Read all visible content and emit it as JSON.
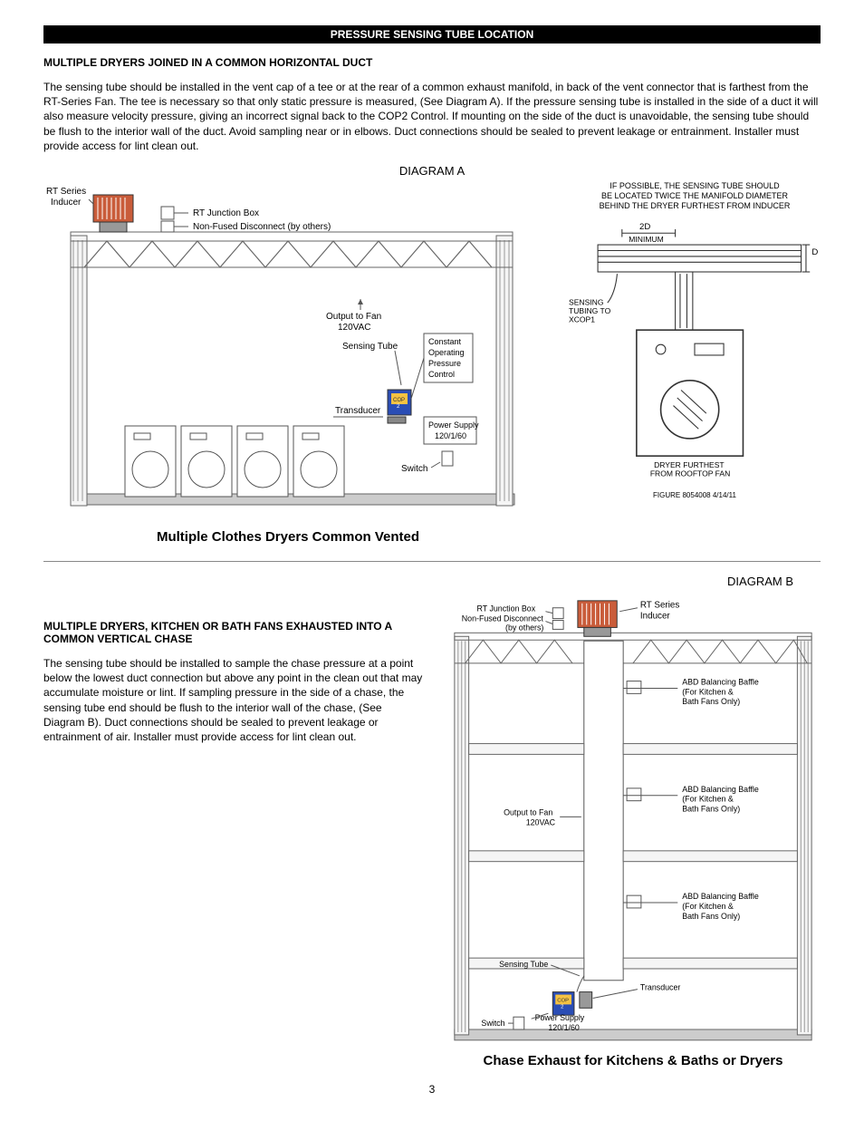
{
  "section_bar": "PRESSURE SENSING TUBE LOCATION",
  "sectionA": {
    "heading": "MULTIPLE DRYERS JOINED IN A COMMON HORIZONTAL DUCT",
    "para": "The sensing tube should be installed in the vent cap of a tee or at the rear of a common exhaust manifold, in back of the vent connector that is farthest from the RT-Series Fan. The tee is necessary so that only static pressure is measured, (See Diagram A). If the pressure sensing tube is installed in the side of a duct it will also measure velocity pressure, giving an incorrect signal back to the COP2 Control. If mounting on the side of the duct is unavoidable, the sensing tube should be flush to the interior wall of the duct. Avoid sampling near or in elbows. Duct connections should be sealed to prevent leakage or entrainment. Installer must provide access for lint clean out.",
    "diagram_label": "DIAGRAM A",
    "caption": "Multiple Clothes Dryers Common Vented",
    "callouts": {
      "rt_series": "RT Series",
      "inducer": "Inducer",
      "rt_junction": "RT Junction Box",
      "disconnect": "Non-Fused Disconnect (by others)",
      "output_to_fan": "Output to Fan",
      "voltage": "120VAC",
      "sensing_tube": "Sensing Tube",
      "cop_line1": "Constant",
      "cop_line2": "Operating",
      "cop_line3": "Pressure",
      "cop_line4": "Control",
      "transducer": "Transducer",
      "power_supply": "Power Supply",
      "power_hz": "120/1/60",
      "switch": "Switch"
    },
    "right_note1": "IF POSSIBLE, THE SENSING TUBE SHOULD",
    "right_note2": "BE LOCATED TWICE THE MANIFOLD DIAMETER",
    "right_note3": "BEHIND THE DRYER FURTHEST FROM INDUCER",
    "right_2d": "2D",
    "right_min": "MINIMUM",
    "right_d": "D",
    "right_sensing1": "SENSING",
    "right_sensing2": "TUBING TO",
    "right_sensing3": "XCOP1",
    "right_dryer1": "DRYER FURTHEST",
    "right_dryer2": "FROM ROOFTOP FAN",
    "right_fig": "FIGURE 8054008   4/14/11"
  },
  "sectionB": {
    "heading": "MULTIPLE DRYERS, KITCHEN OR BATH FANS EXHAUSTED INTO A COMMON VERTICAL CHASE",
    "para": "The sensing tube should be installed to sample the chase pressure at a point below the lowest duct connection but above any point in the clean out that may accumulate moisture or lint. If sampling pressure in the side of a chase, the sensing tube end should be flush to the interior wall of the chase, (See Diagram B). Duct connections should be sealed to prevent leakage or entrainment of air. Installer must provide access for lint clean out.",
    "diagram_label": "DIAGRAM B",
    "caption": "Chase Exhaust for Kitchens & Baths or Dryers",
    "callouts": {
      "rt_junction": "RT Junction Box",
      "disconnect": "Non-Fused Disconnect",
      "by_others": "(by others)",
      "rt_series": "RT Series",
      "inducer": "Inducer",
      "abd": "ABD Balancing Baffle",
      "abd_line2": "(For Kitchen &",
      "abd_line3": "Bath Fans Only)",
      "output_to_fan": "Output to Fan",
      "voltage": "120VAC",
      "sensing_tube": "Sensing Tube",
      "transducer": "Transducer",
      "power_supply": "Power Supply",
      "power_hz": "120/1/60",
      "switch": "Switch"
    }
  },
  "page_num": "3"
}
